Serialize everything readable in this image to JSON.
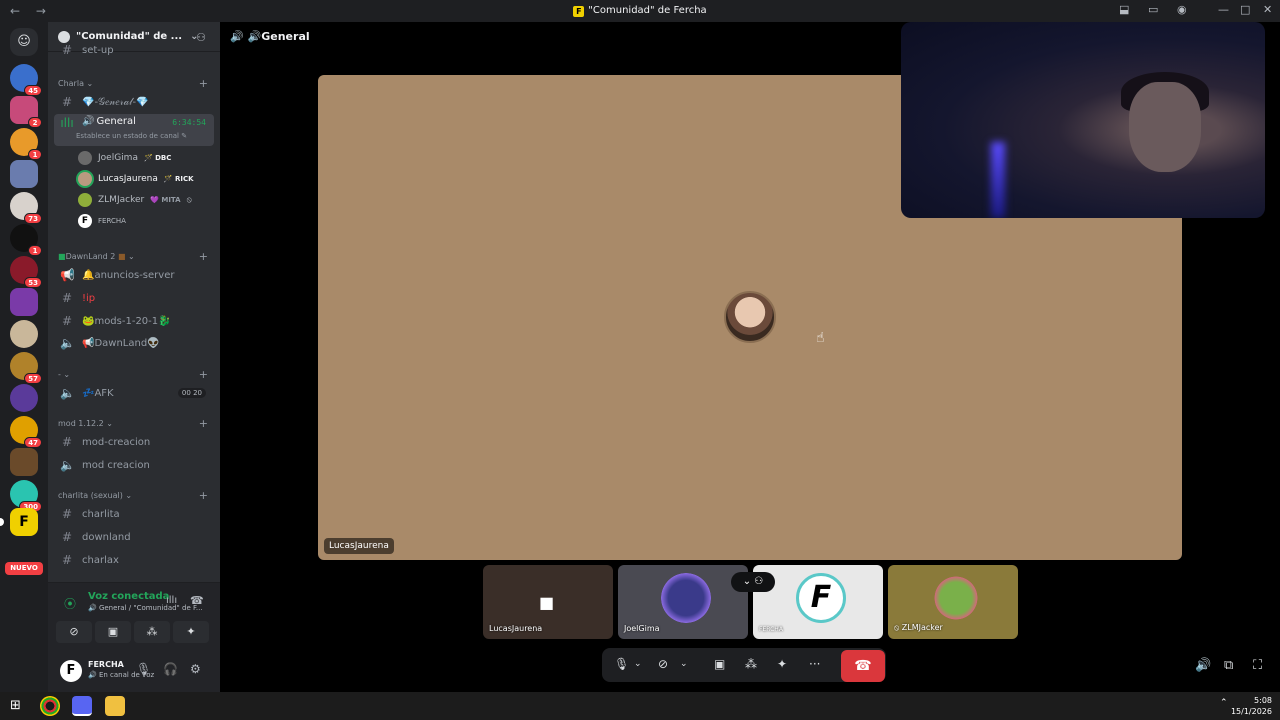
{
  "window": {
    "title": "\"Comunidad\" de Fercha",
    "nav": "← →"
  },
  "servers": {
    "badges": [
      "45",
      "2",
      "1",
      "73",
      "1",
      "53",
      "57",
      "47",
      "300"
    ],
    "nuevo_label": "NUEVO"
  },
  "guild": {
    "name": "\"Comunidad\" de ...",
    "prev_channel": "set-up",
    "categories": {
      "charla": "Charla",
      "dawnland": "DawnLand 2",
      "dash": "-",
      "mod": "mod 1.12.2",
      "charlita": "charlita (sexual)"
    },
    "channels": {
      "general_text": "💎-𝒢𝑒𝓃𝑒𝓇𝒶𝓁-💎",
      "general_voice": "General",
      "general_time": "6:34:54",
      "general_status": "Establece un estado de canal",
      "anuncios": "🔔anuncios-server",
      "ip": "!ip",
      "mods": "🐸mods-1-20-1🐉",
      "dawnland_voice": "📢DawnLand👽",
      "afk": "💤AFK",
      "afk_count_a": "00",
      "afk_count_b": "20",
      "mod_creacion_text": "mod-creacion",
      "mod_creacion_voice": "mod creacion",
      "charlita": "charlita",
      "downland": "downland",
      "charlax": "charlax"
    },
    "voice_users": [
      {
        "name": "JoelGima",
        "tag": "🪄 DBC"
      },
      {
        "name": "LucasJaurena",
        "tag": "🪄 RICK"
      },
      {
        "name": "ZLMJacker",
        "tag": "💜 MITA"
      },
      {
        "name": "FERCHA",
        "tag": ""
      }
    ]
  },
  "voice_panel": {
    "status": "Voz conectada",
    "location": "General / \"Comunidad\" de F..."
  },
  "user": {
    "name": "FERCHA",
    "status": "En canal de voz",
    "avatar_letter": "F"
  },
  "stage": {
    "channel_title": "General",
    "main_tile_name": "LucasJaurena",
    "thumbnails": [
      "LucasJaurena",
      "JoelGima",
      "FERCHA",
      "ZLMJacker"
    ]
  },
  "taskbar": {
    "time": "5:08",
    "date": "15/1/2026"
  },
  "colors": {
    "accent_green": "#23a55a",
    "hangup_red": "#da373c",
    "badge_red": "#f23f43",
    "main_tile_bg": "#a98a69"
  }
}
